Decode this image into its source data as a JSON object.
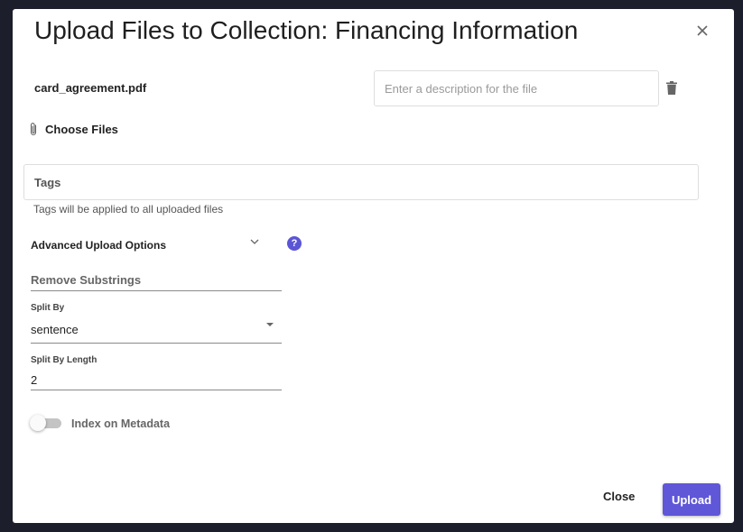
{
  "dialog": {
    "title": "Upload Files to Collection: Financing Information",
    "close_icon": "close-x-icon"
  },
  "file": {
    "name": "card_agreement.pdf",
    "description_placeholder": "Enter a description for the file",
    "description_value": "",
    "delete_icon": "trash-icon"
  },
  "choose_files": {
    "label": "Choose Files",
    "icon": "paperclip-icon"
  },
  "tags": {
    "placeholder": "Tags",
    "help": "Tags will be applied to all uploaded files"
  },
  "advanced": {
    "label": "Advanced Upload Options",
    "expanded": true,
    "help_glyph": "?",
    "remove_substrings_placeholder": "Remove Substrings",
    "split_by_label": "Split By",
    "split_by_value": "sentence",
    "split_by_length_label": "Split By Length",
    "split_by_length_value": "2",
    "index_on_metadata_label": "Index on Metadata",
    "index_on_metadata_enabled": false
  },
  "footer": {
    "close_label": "Close",
    "upload_label": "Upload"
  },
  "colors": {
    "accent": "#5f57d8",
    "backdrop": "#1c1e2b"
  }
}
